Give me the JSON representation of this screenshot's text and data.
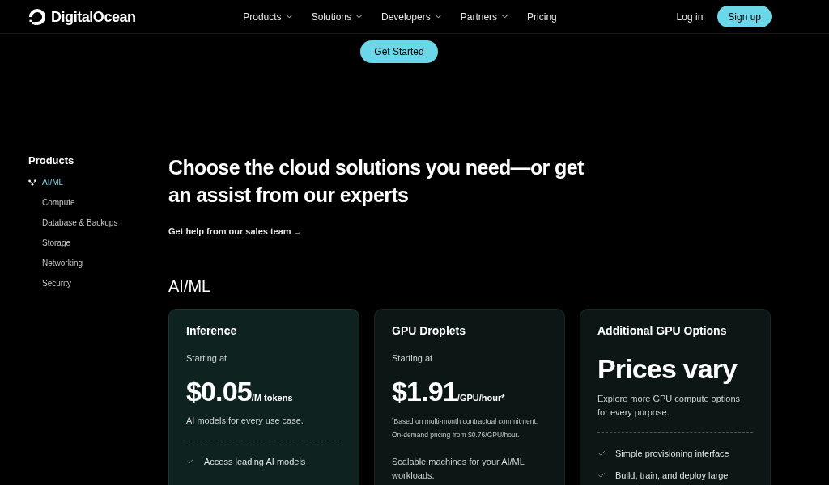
{
  "nav": {
    "logo": "DigitalOcean",
    "menu": [
      {
        "label": "Products",
        "dropdown": true
      },
      {
        "label": "Solutions",
        "dropdown": true
      },
      {
        "label": "Developers",
        "dropdown": true
      },
      {
        "label": "Partners",
        "dropdown": true
      },
      {
        "label": "Pricing",
        "dropdown": false
      }
    ],
    "login": "Log in",
    "signup": "Sign up"
  },
  "cta": "Get Started",
  "sidebar": {
    "title": "Products",
    "items": [
      {
        "label": "AI/ML",
        "selected": true
      },
      {
        "label": "Compute",
        "selected": false
      },
      {
        "label": "Database & Backups",
        "selected": false
      },
      {
        "label": "Storage",
        "selected": false
      },
      {
        "label": "Networking",
        "selected": false
      },
      {
        "label": "Security",
        "selected": false
      }
    ]
  },
  "hero": {
    "heading": "Choose the cloud solutions you need—or get an assist from our experts",
    "link": "Get help from our sales team →"
  },
  "section": {
    "title": "AI/ML",
    "cards": [
      {
        "kind": "price",
        "highlighted": true,
        "title": "Inference",
        "price_label": "Starting at",
        "price": "$0.05",
        "unit": "/M tokens",
        "description": "AI models for every use case.",
        "features": [
          "Access leading AI models"
        ]
      },
      {
        "kind": "price",
        "highlighted": false,
        "title": "GPU Droplets",
        "price_label": "Starting at",
        "price": "$1.91",
        "unit": "/GPU/hour*",
        "footnote": [
          "$^{*}$Based on multi-month contractual commitment.",
          "On-demand pricing from $0.76/GPU/hour."
        ],
        "description": "Scalable machines for your AI/ML workloads."
      },
      {
        "kind": "quote",
        "highlighted": false,
        "title": "Additional GPU Options",
        "headline": "Prices vary",
        "description": "Explore more GPU compute options for every purpose.",
        "features": [
          "Simple provisioning interface",
          "Build, train, and deploy large"
        ]
      }
    ]
  }
}
